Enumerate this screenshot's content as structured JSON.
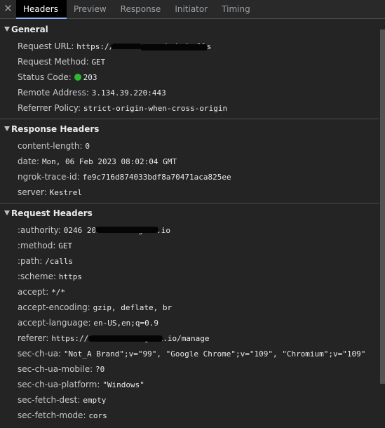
{
  "tabs": [
    {
      "label": "Headers"
    },
    {
      "label": "Preview"
    },
    {
      "label": "Response"
    },
    {
      "label": "Initiator"
    },
    {
      "label": "Timing"
    }
  ],
  "general": {
    "title": "General",
    "rows": [
      {
        "key": "Request URL:",
        "value": "https://024— —.ngrok.io/calls"
      },
      {
        "key": "Request Method:",
        "value": "GET"
      },
      {
        "key": "Status Code:",
        "value": "203"
      },
      {
        "key": "Remote Address:",
        "value": "3.134.39.220:443"
      },
      {
        "key": "Referrer Policy:",
        "value": "strict-origin-when-cross-origin"
      }
    ]
  },
  "response_headers": {
    "title": "Response Headers",
    "rows": [
      {
        "key": "content-length:",
        "value": "0"
      },
      {
        "key": "date:",
        "value": "Mon, 06 Feb 2023 08:02:04 GMT"
      },
      {
        "key": "ngrok-trace-id:",
        "value": "fe9c716d874033bdf8a70471aca825ee"
      },
      {
        "key": "server:",
        "value": "Kestrel"
      }
    ]
  },
  "request_headers": {
    "title": "Request Headers",
    "rows": [
      {
        "key": ":authority:",
        "value": "0246 202 — 111.ngrok.io"
      },
      {
        "key": ":method:",
        "value": "GET"
      },
      {
        "key": ":path:",
        "value": "/calls"
      },
      {
        "key": ":scheme:",
        "value": "https"
      },
      {
        "key": "accept:",
        "value": "*/*"
      },
      {
        "key": "accept-encoding:",
        "value": "gzip, deflate, br"
      },
      {
        "key": "accept-language:",
        "value": "en-US,en;q=0.9"
      },
      {
        "key": "referer:",
        "value": "https://024— —-111.ngrok.io/manage"
      },
      {
        "key": "sec-ch-ua:",
        "value": "\"Not_A Brand\";v=\"99\", \"Google Chrome\";v=\"109\", \"Chromium\";v=\"109\""
      },
      {
        "key": "sec-ch-ua-mobile:",
        "value": "?0"
      },
      {
        "key": "sec-ch-ua-platform:",
        "value": "\"Windows\""
      },
      {
        "key": "sec-fetch-dest:",
        "value": "empty"
      },
      {
        "key": "sec-fetch-mode:",
        "value": "cors"
      }
    ]
  },
  "colors": {
    "background": "#242424",
    "active_tab_underline": "#8ab4f8",
    "status_ok": "#2eb82e"
  }
}
